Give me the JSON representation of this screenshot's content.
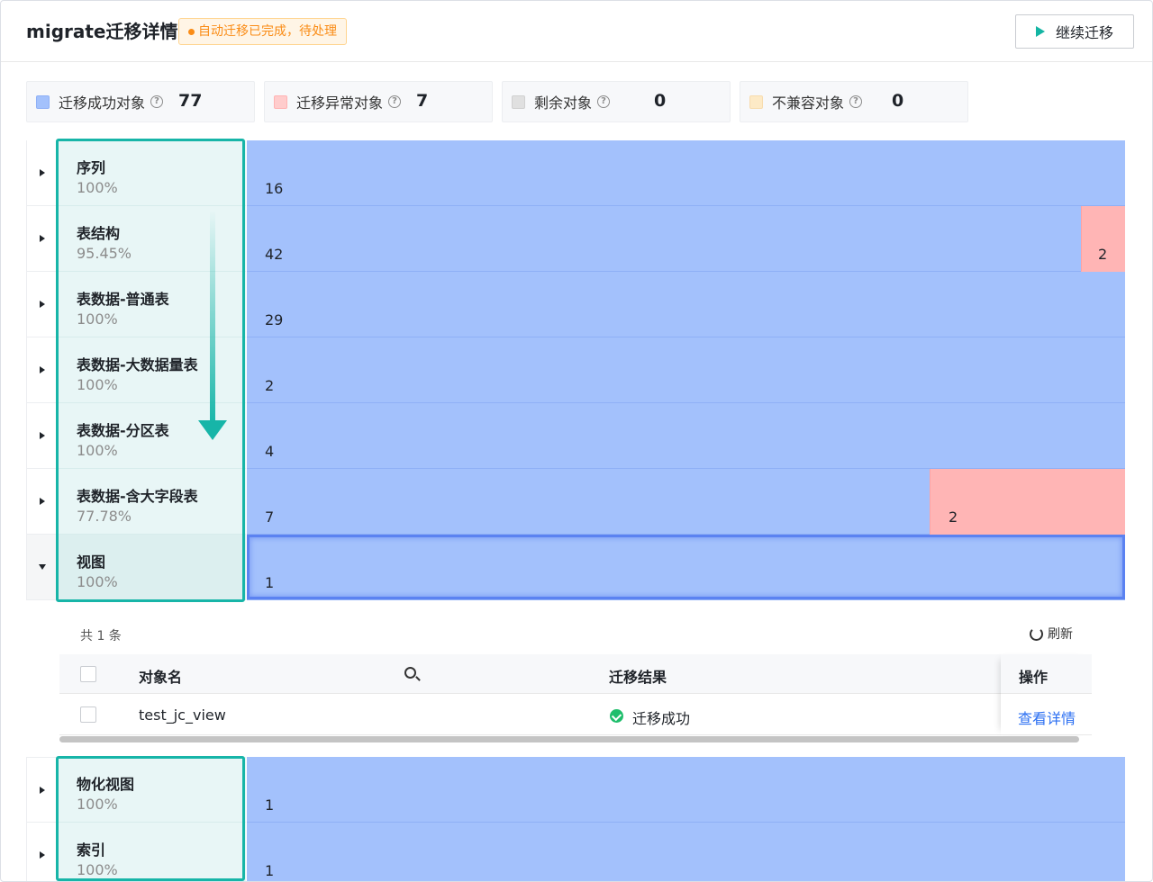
{
  "header": {
    "title": "migrate迁移详情",
    "status": "自动迁移已完成，待处理",
    "continue_label": "继续迁移"
  },
  "summary": [
    {
      "label": "迁移成功对象",
      "value": "77",
      "color": "#a3c1fc"
    },
    {
      "label": "迁移异常对象",
      "value": "7",
      "color": "#ffcccc"
    },
    {
      "label": "剩余对象",
      "value": "0",
      "color": "#e0e0e0"
    },
    {
      "label": "不兼容对象",
      "value": "0",
      "color": "#fdeac6"
    }
  ],
  "categories": [
    {
      "name": "序列",
      "percent": "100%",
      "success": "16",
      "error": ""
    },
    {
      "name": "表结构",
      "percent": "95.45%",
      "success": "42",
      "error": "2"
    },
    {
      "name": "表数据-普通表",
      "percent": "100%",
      "success": "29",
      "error": ""
    },
    {
      "name": "表数据-大数据量表",
      "percent": "100%",
      "success": "2",
      "error": ""
    },
    {
      "name": "表数据-分区表",
      "percent": "100%",
      "success": "4",
      "error": ""
    },
    {
      "name": "表数据-含大字段表",
      "percent": "77.78%",
      "success": "7",
      "error": "2"
    },
    {
      "name": "视图",
      "percent": "100%",
      "success": "1",
      "error": ""
    },
    {
      "name": "物化视图",
      "percent": "100%",
      "success": "1",
      "error": ""
    },
    {
      "name": "索引",
      "percent": "100%",
      "success": "1",
      "error": ""
    }
  ],
  "detail": {
    "count_text": "共 1 条",
    "refresh_label": "刷新",
    "columns": {
      "name": "对象名",
      "result": "迁移结果",
      "action": "操作"
    },
    "rows": [
      {
        "name": "test_jc_view",
        "result": "迁移成功",
        "action": "查看详情"
      }
    ]
  }
}
